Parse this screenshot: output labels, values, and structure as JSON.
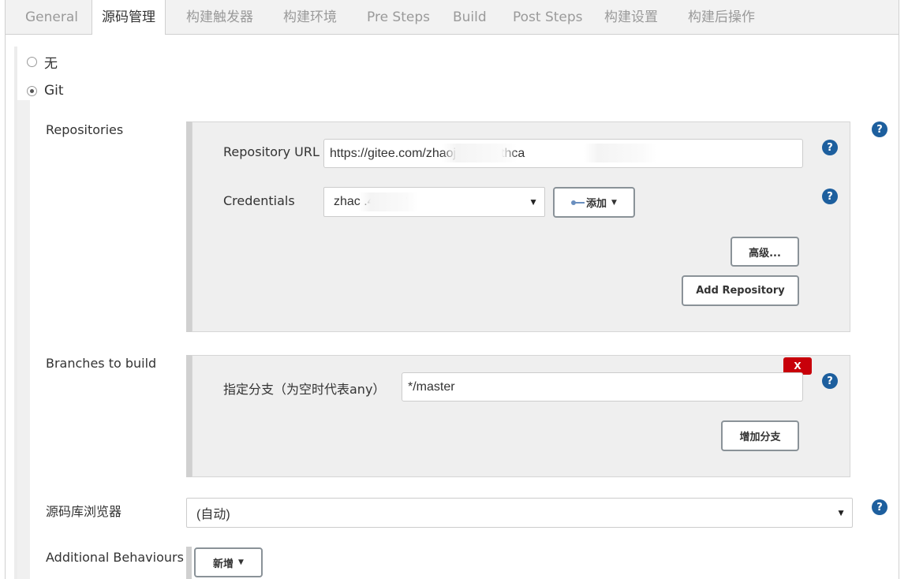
{
  "tabs": [
    {
      "label": "General"
    },
    {
      "label": "源码管理"
    },
    {
      "label": "构建触发器"
    },
    {
      "label": "构建环境"
    },
    {
      "label": "Pre Steps"
    },
    {
      "label": "Build"
    },
    {
      "label": "Post Steps"
    },
    {
      "label": "构建设置"
    },
    {
      "label": "构建后操作"
    }
  ],
  "scm": {
    "option_none": "无",
    "option_git": "Git",
    "selected": "Git"
  },
  "repositories": {
    "section_label": "Repositories",
    "url_label": "Repository URL",
    "url_value": "https://gitee.com/zhaoj          14/healthca",
    "credentials_label": "Credentials",
    "credentials_value": "zhac                .4/******",
    "add_button": "添加",
    "advanced_button": "高级...",
    "add_repository_button": "Add Repository"
  },
  "branches": {
    "section_label": "Branches to build",
    "delete_button": "X",
    "branch_label": "指定分支（为空时代表any）",
    "branch_value": "*/master",
    "add_branch_button": "增加分支"
  },
  "browser": {
    "label": "源码库浏览器",
    "value": "(自动)"
  },
  "behaviours": {
    "label": "Additional Behaviours",
    "add_button": "新增"
  },
  "help_icon_glyph": "?",
  "colors": {
    "help": "#1d5f9e",
    "danger": "#c8000a",
    "tab_bg": "#f2f2f2"
  }
}
